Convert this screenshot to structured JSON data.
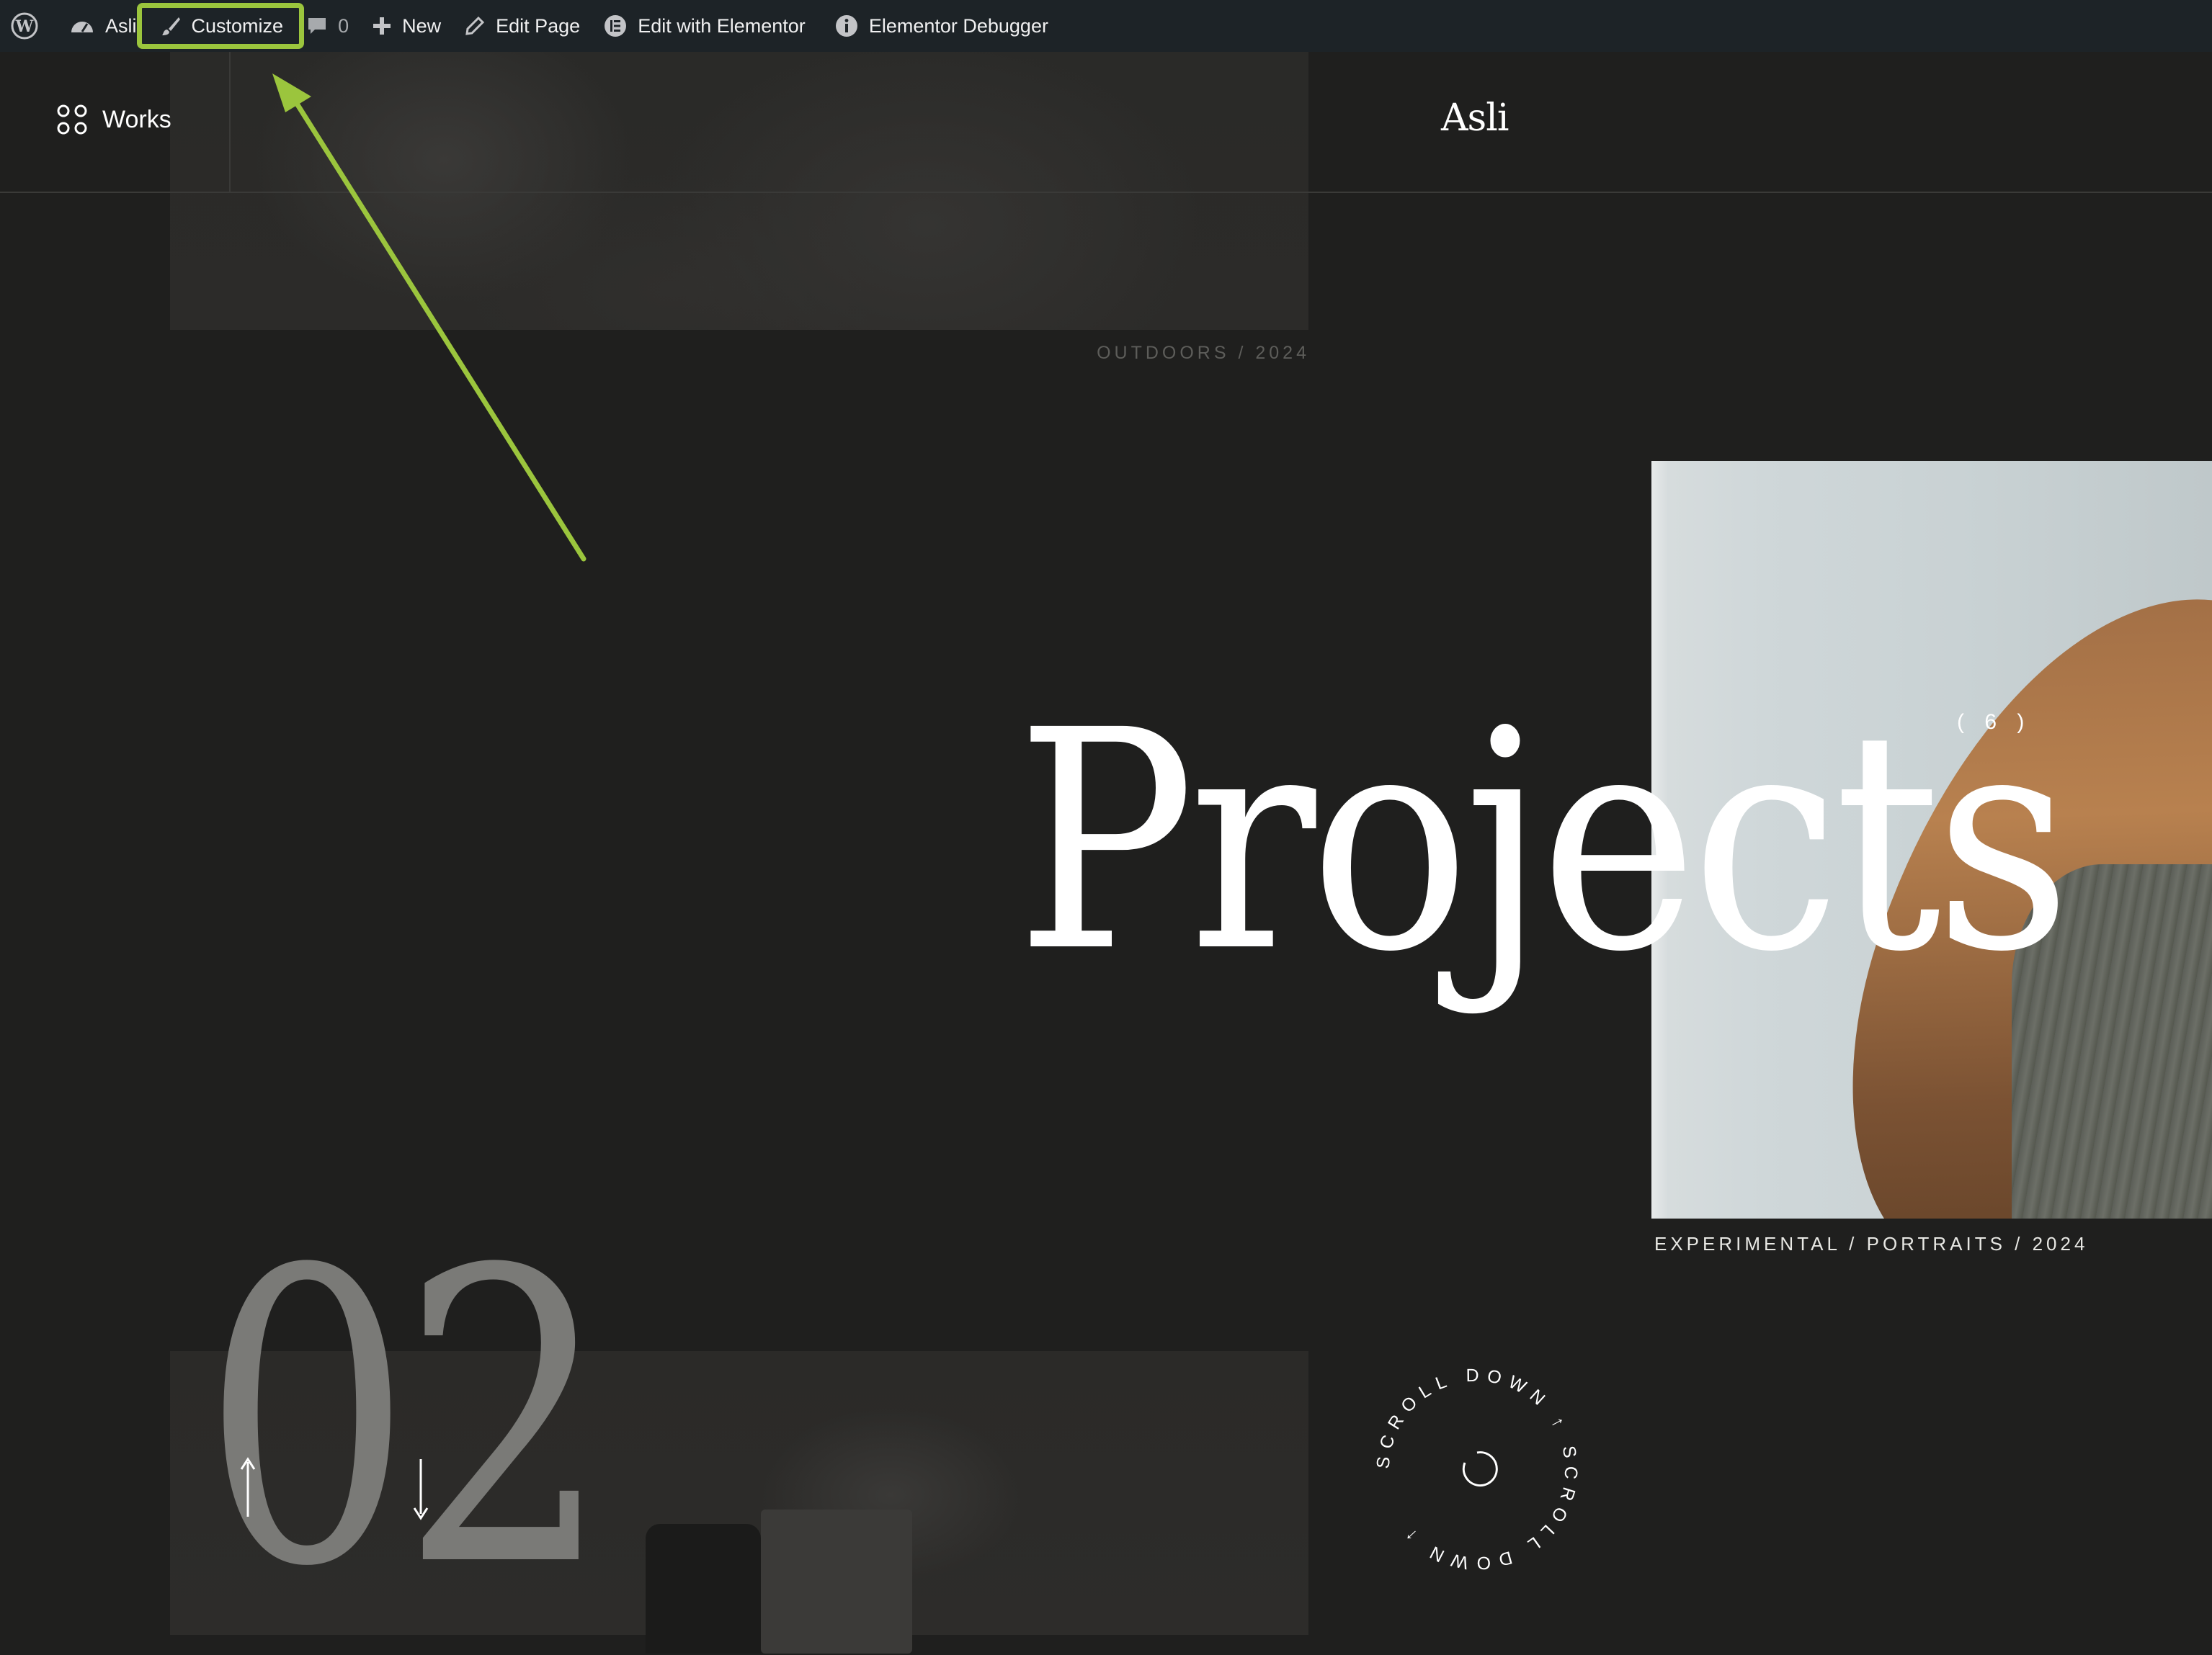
{
  "admin_bar": {
    "site_name": "Asli",
    "customize_label": "Customize",
    "comments_count": "0",
    "new_label": "New",
    "edit_page_label": "Edit Page",
    "edit_elementor_label": "Edit with Elementor",
    "debugger_label": "Elementor Debugger"
  },
  "header": {
    "nav_label": "Works",
    "logo_text": "Asli"
  },
  "gallery": {
    "top_caption": "OUTDOORS / 2024",
    "portrait_caption": "EXPERIMENTAL / PORTRAITS / 2024"
  },
  "hero": {
    "title": "Projects",
    "count": "( 6 )",
    "index_number": "02"
  },
  "scroll_badge": {
    "text": "SCROLL DOWN ↑ SCROLL DOWN ↑ "
  },
  "colors": {
    "admin_bar_bg": "#1d2327",
    "page_bg": "#1f1f1e",
    "highlight": "#9bc53d"
  },
  "icons": {
    "wp": "wordpress-icon",
    "dashboard": "dashboard-icon",
    "customize": "brush-icon",
    "comments": "comment-icon",
    "new": "plus-icon",
    "edit": "pencil-icon",
    "elementor": "elementor-icon",
    "info": "info-icon",
    "works": "grid-dots-icon"
  }
}
